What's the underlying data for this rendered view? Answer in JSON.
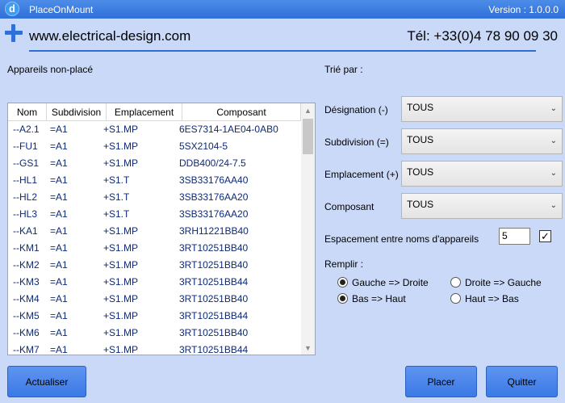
{
  "window": {
    "title": "PlaceOnMount",
    "version": "Version : 1.0.0.0",
    "icon_letter": "d"
  },
  "header": {
    "website": "www.electrical-design.com",
    "phone": "Tél: +33(0)4 78 90 09 30"
  },
  "left": {
    "section_label": "Appareils non-placé",
    "columns": [
      "Nom",
      "Subdivision",
      "Emplacement",
      "Composant"
    ],
    "rows": [
      [
        "--A2.1",
        "=A1",
        "+S1.MP",
        "6ES7314-1AE04-0AB0"
      ],
      [
        "--FU1",
        "=A1",
        "+S1.MP",
        "5SX2104-5"
      ],
      [
        "--GS1",
        "=A1",
        "+S1.MP",
        "DDB400/24-7.5"
      ],
      [
        "--HL1",
        "=A1",
        "+S1.T",
        "3SB33176AA40"
      ],
      [
        "--HL2",
        "=A1",
        "+S1.T",
        "3SB33176AA20"
      ],
      [
        "--HL3",
        "=A1",
        "+S1.T",
        "3SB33176AA20"
      ],
      [
        "--KA1",
        "=A1",
        "+S1.MP",
        "3RH11221BB40"
      ],
      [
        "--KM1",
        "=A1",
        "+S1.MP",
        "3RT10251BB40"
      ],
      [
        "--KM2",
        "=A1",
        "+S1.MP",
        "3RT10251BB40"
      ],
      [
        "--KM3",
        "=A1",
        "+S1.MP",
        "3RT10251BB44"
      ],
      [
        "--KM4",
        "=A1",
        "+S1.MP",
        "3RT10251BB40"
      ],
      [
        "--KM5",
        "=A1",
        "+S1.MP",
        "3RT10251BB44"
      ],
      [
        "--KM6",
        "=A1",
        "+S1.MP",
        "3RT10251BB40"
      ],
      [
        "--KM7",
        "=A1",
        "+S1.MP",
        "3RT10251BB44"
      ]
    ]
  },
  "right": {
    "sort_label": "Trié par :",
    "filters": [
      {
        "label": "Désignation (-)",
        "value": "TOUS"
      },
      {
        "label": "Subdivision (=)",
        "value": "TOUS"
      },
      {
        "label": "Emplacement (+)",
        "value": "TOUS"
      },
      {
        "label": "Composant",
        "value": "TOUS"
      }
    ],
    "spacing_label": "Espacement entre noms d'appareils",
    "spacing_value": "5",
    "spacing_checked": true,
    "fill_label": "Remplir :",
    "fill_options": [
      {
        "label": "Gauche => Droite",
        "selected": true
      },
      {
        "label": "Droite => Gauche",
        "selected": false
      },
      {
        "label": "Bas => Haut",
        "selected": true
      },
      {
        "label": "Haut => Bas",
        "selected": false
      }
    ]
  },
  "buttons": {
    "refresh": "Actualiser",
    "place": "Placer",
    "quit": "Quitter"
  },
  "colors": {
    "background": "#c9d9f7",
    "titlebar": "#2f6fd8",
    "button": "#4a84ea",
    "list_text": "#0c2a78"
  },
  "icons": {
    "app": "app-d-icon",
    "add": "plus-icon",
    "dropdown": "chevron-down-icon",
    "check": "check-icon"
  }
}
